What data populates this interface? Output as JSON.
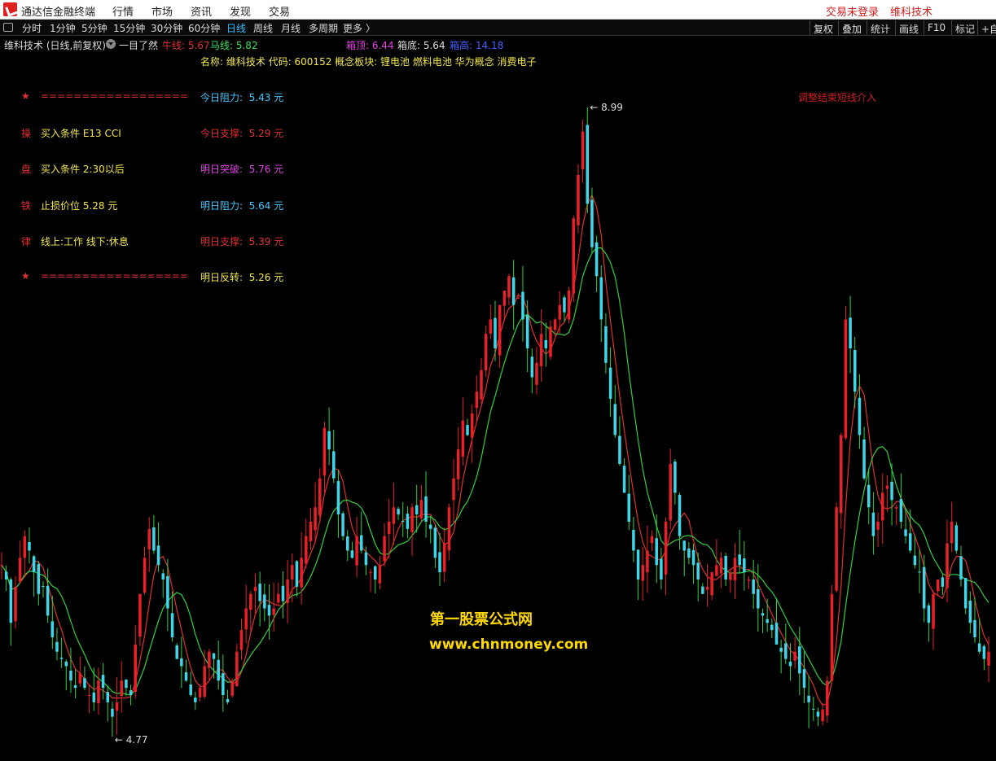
{
  "app": {
    "title": "通达信金融终端",
    "login_status": "交易未登录",
    "stock_title": "维科技术"
  },
  "menu": [
    "行情",
    "市场",
    "资讯",
    "发现",
    "交易"
  ],
  "periods": [
    "分时",
    "1分钟",
    "5分钟",
    "15分钟",
    "30分钟",
    "60分钟",
    "日线",
    "周线",
    "月线",
    "多周期",
    "更多 〉"
  ],
  "active_period": "日线",
  "right_buttons": [
    "复权",
    "叠加",
    "统计",
    "画线",
    "F10",
    "标记",
    "+自"
  ],
  "indicator": {
    "name": "维科技术 (日线,前复权)",
    "formula": "一目了然",
    "bull_line": "牛线: 5.67",
    "horse_line": "马线: 5.82",
    "box_top": "箱顶: 6.44",
    "box_bottom": "箱底: 5.64",
    "box_high": "箱高: 14.18"
  },
  "info_line": "名称: 维科技术  代码: 600152  概念板块: 锂电池  燃料电池  华为概念  消费电子",
  "rules": [
    {
      "key": "★",
      "text": "=================="
    },
    {
      "key": "操",
      "text": "买入条件 E13 CCI"
    },
    {
      "key": "盘",
      "text": "买入条件 2:30以后"
    },
    {
      "key": "铁",
      "text": "止损价位 5.28 元"
    },
    {
      "key": "律",
      "text": "线上:工作 线下:休息"
    },
    {
      "key": "★",
      "text": "=================="
    }
  ],
  "levels": [
    {
      "label": "今日阻力:",
      "value": "5.43 元",
      "color": "#3ec8ff"
    },
    {
      "label": "今日支撑:",
      "value": "5.29 元",
      "color": "#e03030"
    },
    {
      "label": "明日突破:",
      "value": "5.76 元",
      "color": "#e040e0"
    },
    {
      "label": "明日阻力:",
      "value": "5.64 元",
      "color": "#3ec8ff"
    },
    {
      "label": "明日支撑:",
      "value": "5.39 元",
      "color": "#e03030"
    },
    {
      "label": "明日反转:",
      "value": "5.26 元",
      "color": "#f2e64a"
    }
  ],
  "hint": "调整结束短线介入",
  "watermark": {
    "cn": "第一股票公式网",
    "url": "www.chnmoney.com"
  },
  "chart_data": {
    "type": "candlestick",
    "ylim": [
      4.6,
      9.4
    ],
    "high_label": "8.99",
    "low_label": "4.77",
    "closes": [
      5.9,
      5.8,
      5.5,
      5.75,
      5.95,
      6.1,
      6.0,
      5.85,
      5.7,
      5.75,
      5.55,
      5.4,
      5.3,
      5.25,
      5.2,
      5.1,
      5.05,
      5.15,
      5.05,
      5.0,
      4.95,
      5.1,
      5.05,
      4.95,
      4.85,
      4.95,
      5.1,
      5.05,
      5.0,
      5.35,
      5.7,
      5.95,
      6.15,
      6.0,
      5.9,
      5.8,
      5.6,
      5.4,
      5.25,
      5.2,
      5.1,
      5.0,
      4.95,
      5.05,
      5.2,
      5.3,
      5.25,
      5.1,
      5.0,
      4.95,
      5.1,
      5.3,
      5.45,
      5.6,
      5.7,
      5.75,
      5.65,
      5.6,
      5.55,
      5.6,
      5.7,
      5.65,
      5.8,
      5.9,
      5.75,
      5.95,
      6.1,
      6.2,
      6.3,
      6.5,
      6.85,
      6.7,
      6.5,
      6.25,
      6.1,
      6.0,
      5.95,
      6.1,
      6.0,
      5.9,
      5.85,
      5.8,
      5.9,
      6.1,
      6.2,
      6.3,
      6.25,
      6.2,
      6.15,
      6.3,
      6.25,
      6.35,
      6.2,
      6.15,
      5.95,
      5.85,
      6.05,
      6.3,
      6.5,
      6.7,
      6.9,
      6.8,
      6.95,
      7.1,
      7.25,
      7.5,
      7.6,
      7.4,
      7.7,
      7.8,
      7.9,
      7.7,
      7.75,
      7.6,
      7.4,
      7.2,
      7.3,
      7.5,
      7.4,
      7.55,
      7.6,
      7.7,
      7.65,
      7.8,
      8.3,
      8.6,
      8.9,
      8.4,
      8.1,
      7.9,
      7.6,
      7.3,
      7.05,
      6.8,
      6.6,
      6.4,
      6.2,
      6.0,
      5.8,
      5.9,
      6.0,
      6.1,
      5.9,
      5.8,
      6.2,
      6.6,
      6.4,
      6.1,
      6.0,
      5.95,
      5.9,
      5.8,
      5.7,
      5.75,
      5.85,
      5.9,
      5.95,
      5.8,
      5.85,
      5.95,
      5.9,
      5.85,
      5.8,
      5.7,
      5.6,
      5.55,
      5.5,
      5.45,
      5.35,
      5.3,
      5.25,
      5.2,
      5.3,
      5.15,
      5.05,
      4.95,
      4.9,
      4.85,
      4.9,
      5.1,
      5.7,
      6.3,
      6.8,
      7.6,
      7.4,
      7.1,
      6.8,
      6.5,
      6.3,
      6.1,
      6.2,
      6.4,
      6.45,
      6.35,
      6.3,
      6.2,
      6.1,
      6.0,
      5.9,
      5.85,
      5.6,
      5.5,
      5.7,
      5.8,
      5.75,
      6.05,
      6.2,
      6.0,
      5.8,
      5.6,
      5.5,
      5.4,
      5.3,
      5.25,
      5.3
    ]
  }
}
